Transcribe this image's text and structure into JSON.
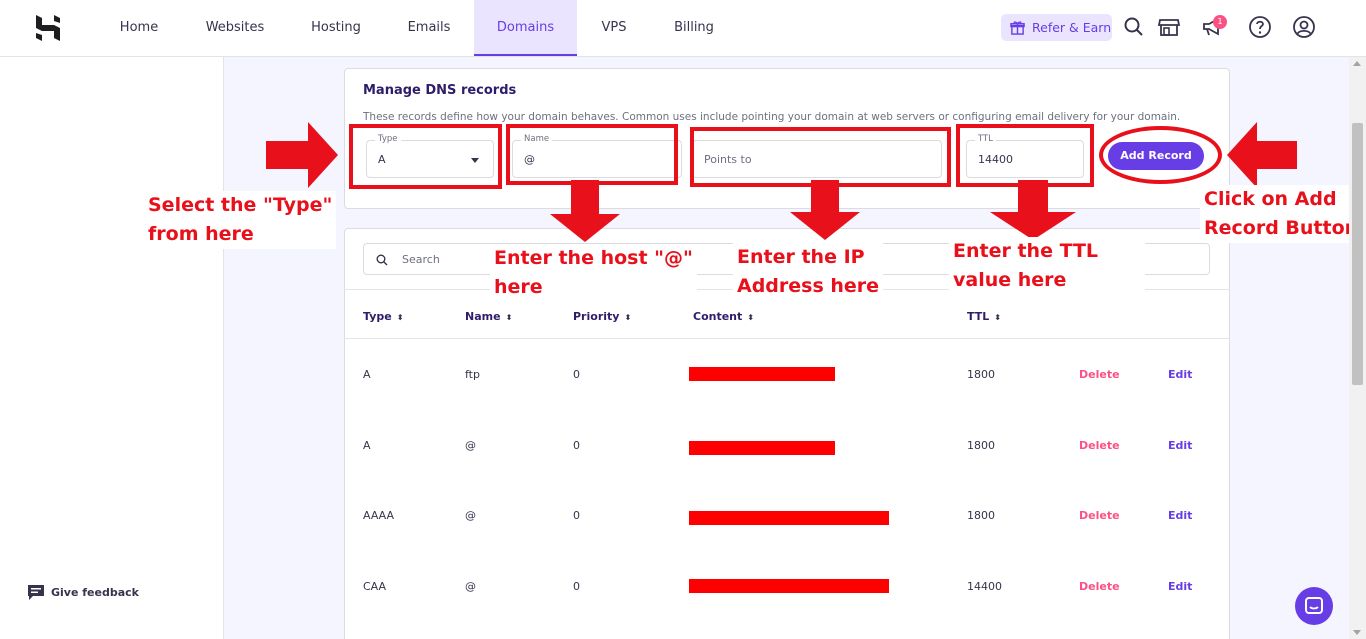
{
  "nav": {
    "items": [
      {
        "label": "Home"
      },
      {
        "label": "Websites"
      },
      {
        "label": "Hosting"
      },
      {
        "label": "Emails"
      },
      {
        "label": "Domains",
        "active": true
      },
      {
        "label": "VPS"
      },
      {
        "label": "Billing"
      }
    ],
    "refer_label": "Refer & Earn",
    "notification_count": "1",
    "icons": [
      "search-icon",
      "store-icon",
      "megaphone-icon",
      "help-icon",
      "account-icon"
    ]
  },
  "sidebar": {
    "feedback_label": "Give feedback"
  },
  "dns": {
    "title": "Manage DNS records",
    "description": "These records define how your domain behaves. Common uses include pointing your domain at web servers or configuring email delivery for your domain.",
    "type_label": "Type",
    "type_value": "A",
    "name_label": "Name",
    "name_value": "@",
    "points_to_placeholder": "Points to",
    "ttl_label": "TTL",
    "ttl_value": "14400",
    "add_button": "Add Record"
  },
  "table": {
    "search_placeholder": "Search",
    "columns": [
      "Type",
      "Name",
      "Priority",
      "Content",
      "TTL"
    ],
    "delete_label": "Delete",
    "edit_label": "Edit",
    "rows": [
      {
        "type": "A",
        "name": "ftp",
        "priority": "0",
        "ttl": "1800"
      },
      {
        "type": "A",
        "name": "@",
        "priority": "0",
        "ttl": "1800"
      },
      {
        "type": "AAAA",
        "name": "@",
        "priority": "0",
        "ttl": "1800"
      },
      {
        "type": "CAA",
        "name": "@",
        "priority": "0",
        "ttl": "14400"
      }
    ]
  },
  "annotations": {
    "select_type": [
      "Select the \"Type\"",
      "from here"
    ],
    "enter_host": [
      "Enter the host \"@\"",
      "here"
    ],
    "enter_ip": [
      "Enter the IP",
      "Address here"
    ],
    "enter_ttl": [
      "Enter the TTL",
      "value here"
    ],
    "click_add": [
      "Click on Add",
      "Record Button"
    ]
  },
  "colors": {
    "accent": "#673de6",
    "accent_light": "#ebe4ff",
    "danger": "#fc5185",
    "annotation": "#e8101b"
  }
}
